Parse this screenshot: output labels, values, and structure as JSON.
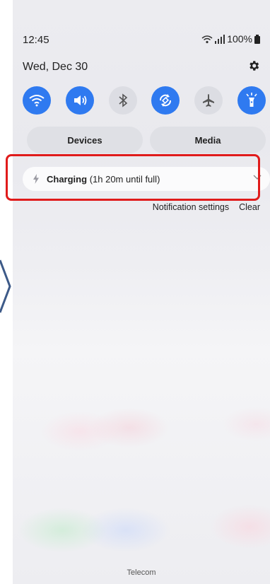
{
  "status_bar": {
    "time": "12:45",
    "battery": "100%"
  },
  "header": {
    "date": "Wed, Dec 30"
  },
  "quick_settings": [
    {
      "name": "wifi",
      "state": "on"
    },
    {
      "name": "sound",
      "state": "on"
    },
    {
      "name": "bluetooth",
      "state": "off"
    },
    {
      "name": "auto-rotate",
      "state": "on"
    },
    {
      "name": "airplane-mode",
      "state": "off"
    },
    {
      "name": "flashlight",
      "state": "on"
    }
  ],
  "buttons": {
    "devices": "Devices",
    "media": "Media"
  },
  "notification": {
    "title": "Charging",
    "detail": "(1h 20m until full)"
  },
  "notification_actions": {
    "settings": "Notification settings",
    "clear": "Clear"
  },
  "footer": {
    "carrier": "Telecom"
  },
  "colors": {
    "accent": "#2f7af0",
    "highlight": "#e01b1b"
  }
}
